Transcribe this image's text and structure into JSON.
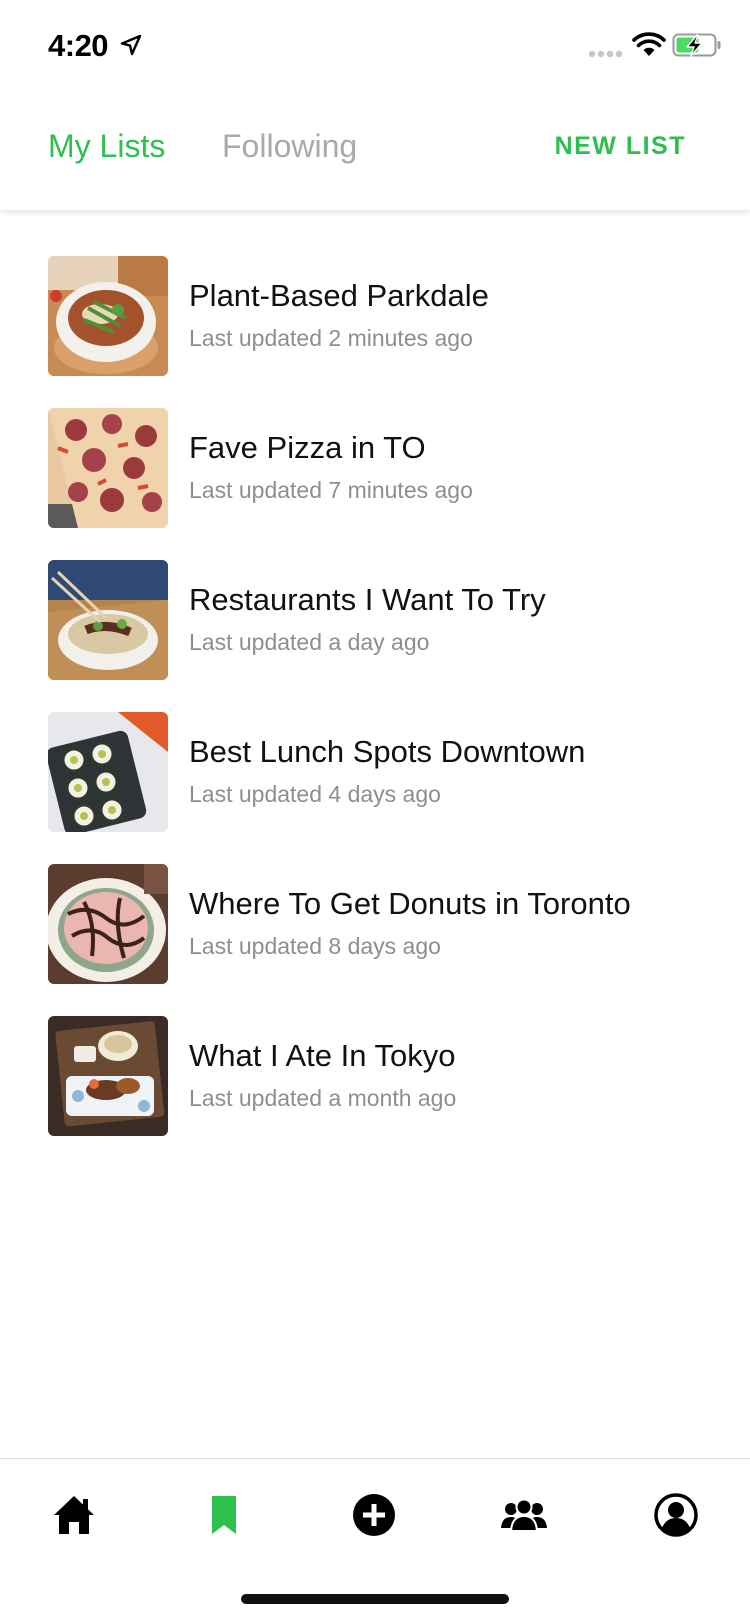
{
  "status_bar": {
    "time": "4:20",
    "icons": [
      "location-arrow-icon",
      "signal-icon",
      "wifi-icon",
      "battery-charging-icon"
    ]
  },
  "header": {
    "tabs": [
      {
        "label": "My Lists",
        "active": true
      },
      {
        "label": "Following",
        "active": false
      }
    ],
    "new_list_label": "NEW LIST"
  },
  "colors": {
    "accent": "#2ec04f",
    "inactive_tab": "#a9a9a9",
    "subtitle": "#8e8e8e"
  },
  "lists": [
    {
      "title": "Plant-Based Parkdale",
      "updated": "Last updated 2 minutes ago",
      "thumb": "pho-bowl"
    },
    {
      "title": "Fave Pizza in TO",
      "updated": "Last updated 7 minutes ago",
      "thumb": "pepperoni-pizza"
    },
    {
      "title": "Restaurants I Want To Try",
      "updated": "Last updated a day ago",
      "thumb": "noodle-bowl"
    },
    {
      "title": "Best Lunch Spots Downtown",
      "updated": "Last updated 4 days ago",
      "thumb": "sushi-rolls"
    },
    {
      "title": "Where To Get Donuts in Toronto",
      "updated": "Last updated 8 days ago",
      "thumb": "chocolate-donut"
    },
    {
      "title": "What I Ate In Tokyo",
      "updated": "Last updated a month ago",
      "thumb": "tokyo-meal-tray"
    }
  ],
  "bottom_nav": [
    {
      "name": "home-icon",
      "active": false
    },
    {
      "name": "bookmark-icon",
      "active": true
    },
    {
      "name": "add-circle-icon",
      "active": false
    },
    {
      "name": "people-icon",
      "active": false
    },
    {
      "name": "profile-icon",
      "active": false
    }
  ]
}
